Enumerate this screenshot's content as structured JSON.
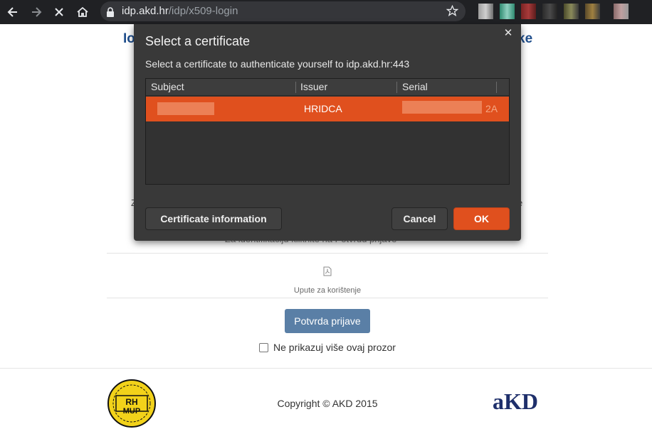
{
  "browser": {
    "url_host": "idp.akd.hr",
    "url_path": "/idp/x509-login"
  },
  "page": {
    "title_left_fragment": "Io",
    "title_right_fragment": "ke",
    "partial_left_char": "Z",
    "partial_right_char": "e",
    "partial_hidden_line": "Za identifikaciju kliknite na Potvrdu prijave",
    "manual_link_label": "Upute za korištenje",
    "confirm_button_label": "Potvrda prijave",
    "dont_show_label": "Ne prikazuj više ovaj prozor",
    "copyright": "Copyright © AKD 2015",
    "mup_logo_text": "RH MUP",
    "akd_logo_text": "AKD"
  },
  "dialog": {
    "title": "Select a certificate",
    "subtitle": "Select a certificate to authenticate yourself to idp.akd.hr:443",
    "columns": [
      "Subject",
      "Issuer",
      "Serial"
    ],
    "rows": [
      {
        "subject": "",
        "issuer": "HRIDCA",
        "serial": "2A"
      }
    ],
    "info_button": "Certificate information",
    "cancel_button": "Cancel",
    "ok_button": "OK"
  },
  "colors": {
    "accent_orange": "#e0501e",
    "dialog_bg": "#393939",
    "chrome_bg": "#202124",
    "title_blue": "#1f4e8c",
    "confirm_blue": "#5a7fa6"
  }
}
